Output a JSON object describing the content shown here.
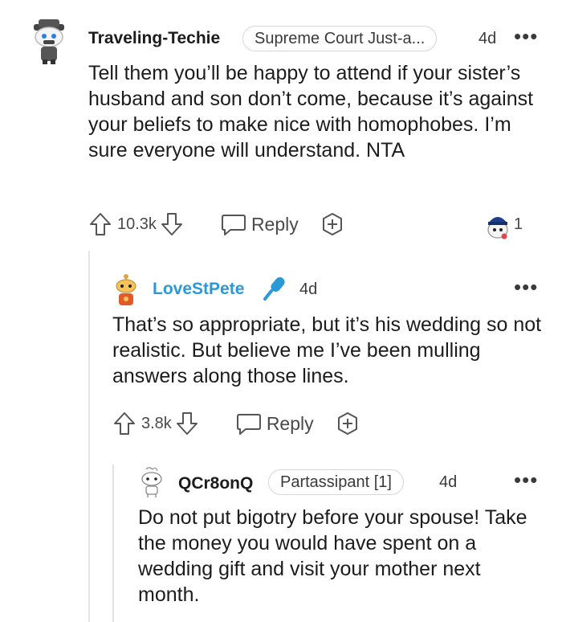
{
  "comments": [
    {
      "author": "Traveling-Techie",
      "flair": "Supreme Court Just-a...",
      "age": "4d",
      "body": "Tell them you’ll be happy to attend if your sister’s husband and son don’t come, because it’s against your beliefs to make nice with homophobes. I’m sure everyone will understand. NTA",
      "votes": "10.3k",
      "reply_label": "Reply",
      "award_count": "1",
      "more": "•••"
    },
    {
      "author": "LoveStPete",
      "age": "4d",
      "body": "That’s so appropriate, but it’s his wedding so not realistic. But believe me I’ve been mulling answers along those lines.",
      "votes": "3.8k",
      "reply_label": "Reply",
      "more": "•••"
    },
    {
      "author": "QCr8onQ",
      "flair": "Partassipant [1]",
      "age": "4d",
      "body": "Do not put bigotry before your spouse! Take the money you would have spent on a wedding gift and visit your mother next month.",
      "more": "•••"
    }
  ],
  "colors": {
    "op_name": "#1c1c1c",
    "mod_name": "#2a9ad6",
    "thread_line": "#e3e3e3",
    "flair_border": "#d6d6d6"
  }
}
